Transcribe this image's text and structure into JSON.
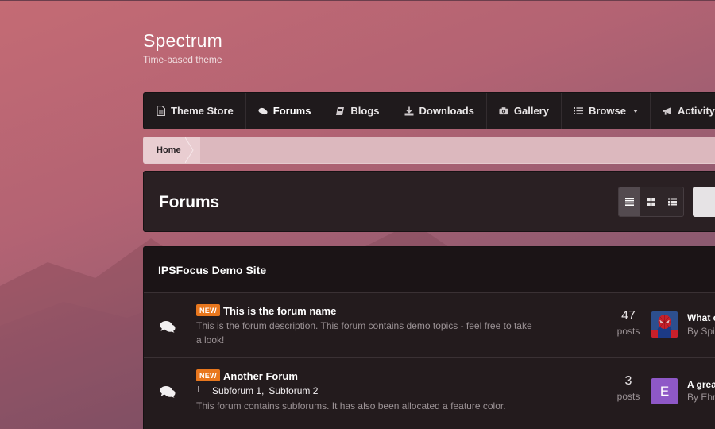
{
  "brand": {
    "title": "Spectrum",
    "subtitle": "Time-based theme"
  },
  "nav": {
    "items": [
      {
        "label": "Theme Store",
        "icon": "document-icon"
      },
      {
        "label": "Forums",
        "icon": "comments-icon",
        "active": true
      },
      {
        "label": "Blogs",
        "icon": "book-icon"
      },
      {
        "label": "Downloads",
        "icon": "download-icon"
      },
      {
        "label": "Gallery",
        "icon": "camera-icon"
      },
      {
        "label": "Browse",
        "icon": "list-icon",
        "dropdown": true
      },
      {
        "label": "Activity",
        "icon": "megaphone-icon",
        "dropdown": true
      }
    ]
  },
  "breadcrumb": {
    "home": "Home"
  },
  "page": {
    "title": "Forums"
  },
  "category": {
    "title": "IPSFocus Demo Site",
    "forums": [
      {
        "badge": "NEW",
        "name": "This is the forum name",
        "description": "This is the forum description. This forum contains demo topics - feel free to take a look!",
        "post_count": "47",
        "post_label": "posts",
        "last_post_title": "What c",
        "last_post_by": "By Spi"
      },
      {
        "badge": "NEW",
        "name": "Another Forum",
        "subforums": [
          "Subforum 1,",
          "Subforum 2"
        ],
        "description": "This forum contains subforums. It has also been allocated a feature color.",
        "post_count": "3",
        "post_label": "posts",
        "avatar_letter": "E",
        "last_post_title": "A grea",
        "last_post_by": "By Ehr"
      }
    ]
  },
  "colors": {
    "new_badge": "#e8771e",
    "avatar_purple": "#8e58c7",
    "nav_bg": "#1f1a1c"
  }
}
